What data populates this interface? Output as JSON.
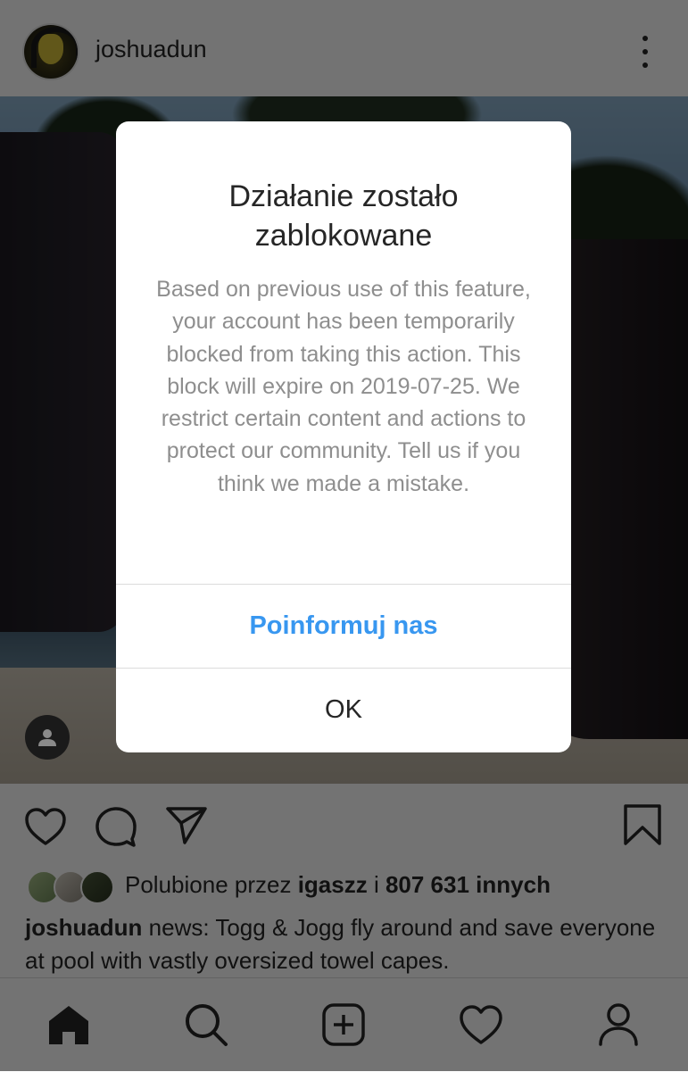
{
  "post": {
    "username": "joshuadun",
    "likes": {
      "prefix": "Polubione przez ",
      "user": "igaszz",
      "connector": " i ",
      "count": "807 631 innych"
    },
    "caption": {
      "username": "joshuadun",
      "text": " news: Togg & Jogg fly around and save everyone at pool with vastly oversized towel capes."
    }
  },
  "icons": {
    "more": "more-vertical-icon",
    "user_tag": "user-tag-icon",
    "like": "heart-icon",
    "comment": "comment-icon",
    "share": "paper-plane-icon",
    "save": "bookmark-icon",
    "nav": [
      "home-icon",
      "search-icon",
      "add-post-icon",
      "activity-heart-icon",
      "profile-icon"
    ]
  },
  "dialog": {
    "title": "Działanie zostało zablokowane",
    "body": "Based on previous use of this feature, your account has been temporarily blocked from taking this action. This block will expire on 2019-07-25. We restrict certain content and actions to protect our community. Tell us if you think we made a mistake.",
    "report_button": "Poinformuj nas",
    "ok_button": "OK"
  },
  "colors": {
    "accent": "#3897f0",
    "text": "#262626",
    "muted": "#8e8e8e",
    "overlay": "rgba(0,0,0,0.55)"
  }
}
